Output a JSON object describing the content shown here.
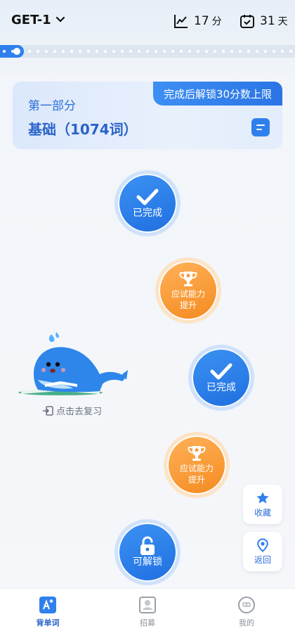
{
  "header": {
    "deck_name": "GET-1",
    "score": {
      "value": "17",
      "unit": "分",
      "icon": "line-chart-icon"
    },
    "days": {
      "value": "31",
      "unit": "天",
      "icon": "calendar-check-icon"
    }
  },
  "progress": {
    "fraction": 0.08
  },
  "section": {
    "part": "第一部分",
    "title": "基础（1074词）",
    "badge": "完成后解锁30分数上限",
    "icon": "book-icon"
  },
  "nodes": [
    {
      "type": "done",
      "label": "已完成",
      "icon": "check-icon"
    },
    {
      "type": "boost",
      "label_line1": "应试能力",
      "label_line2": "提升",
      "icon": "trophy-icon"
    },
    {
      "type": "done",
      "label": "已完成",
      "icon": "check-icon"
    },
    {
      "type": "boost",
      "label_line1": "应试能力",
      "label_line2": "提升",
      "icon": "trophy-icon"
    },
    {
      "type": "unlock",
      "label": "可解锁",
      "icon": "unlock-icon"
    }
  ],
  "review": {
    "label": "点击去复习",
    "icon": "enter-icon"
  },
  "side_actions": {
    "favorite": {
      "label": "收藏",
      "icon": "star-icon"
    },
    "back": {
      "label": "返回",
      "icon": "location-pin-icon"
    }
  },
  "tabs": [
    {
      "label": "背单词",
      "icon": "word-card-icon",
      "active": true
    },
    {
      "label": "招募",
      "icon": "recruit-icon",
      "active": false
    },
    {
      "label": "我的",
      "icon": "robot-face-icon",
      "active": false
    }
  ],
  "colors": {
    "primary": "#2F80ED",
    "accent_orange": "#F48A1F",
    "background": "#F4F6F9"
  }
}
